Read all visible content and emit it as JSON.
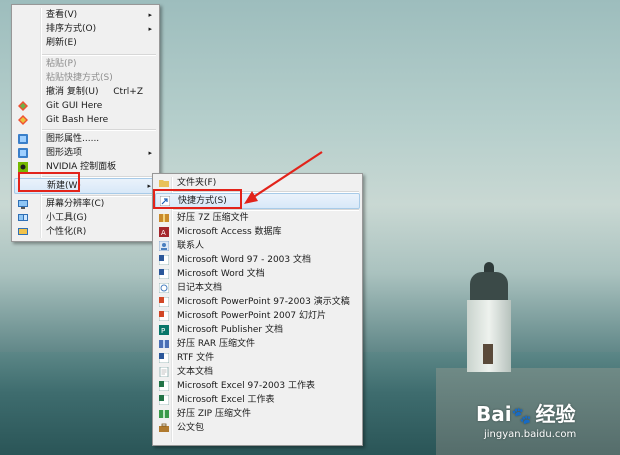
{
  "context_menu": {
    "items": [
      {
        "label": "查看(V)",
        "arrow": "▸"
      },
      {
        "label": "排序方式(O)",
        "arrow": "▸"
      },
      {
        "label": "刷新(E)"
      },
      {
        "label": "粘贴(P)"
      },
      {
        "label": "粘贴快捷方式(S)"
      },
      {
        "label": "撤消 复制(U)",
        "shortcut": "Ctrl+Z"
      },
      {
        "label": "Git GUI Here"
      },
      {
        "label": "Git Bash Here"
      },
      {
        "label": "图形属性......"
      },
      {
        "label": "图形选项",
        "arrow": "▸"
      },
      {
        "label": "NVIDIA 控制面板"
      },
      {
        "label": "新建(W)",
        "arrow": "▸"
      },
      {
        "label": "屏幕分辨率(C)"
      },
      {
        "label": "小工具(G)"
      },
      {
        "label": "个性化(R)"
      }
    ]
  },
  "submenu": {
    "items": [
      {
        "label": "文件夹(F)"
      },
      {
        "label": "快捷方式(S)"
      },
      {
        "label": "好压 7Z 压缩文件"
      },
      {
        "label": "Microsoft Access 数据库"
      },
      {
        "label": "联系人"
      },
      {
        "label": "Microsoft Word 97 - 2003 文档"
      },
      {
        "label": "Microsoft Word 文档"
      },
      {
        "label": "日记本文档"
      },
      {
        "label": "Microsoft PowerPoint 97-2003 演示文稿"
      },
      {
        "label": "Microsoft PowerPoint 2007 幻灯片"
      },
      {
        "label": "Microsoft Publisher 文档"
      },
      {
        "label": "好压 RAR 压缩文件"
      },
      {
        "label": "RTF 文件"
      },
      {
        "label": "文本文档"
      },
      {
        "label": "Microsoft Excel 97-2003 工作表"
      },
      {
        "label": "Microsoft Excel 工作表"
      },
      {
        "label": "好压 ZIP 压缩文件"
      },
      {
        "label": "公文包"
      }
    ]
  },
  "watermark": {
    "logo_left": "Bai",
    "logo_right": "经验",
    "url": "jingyan.baidu.com"
  },
  "colors": {
    "annotation": "#e2231a",
    "menu_bg": "#f0f0f0",
    "highlight": "#d8e8f8"
  }
}
